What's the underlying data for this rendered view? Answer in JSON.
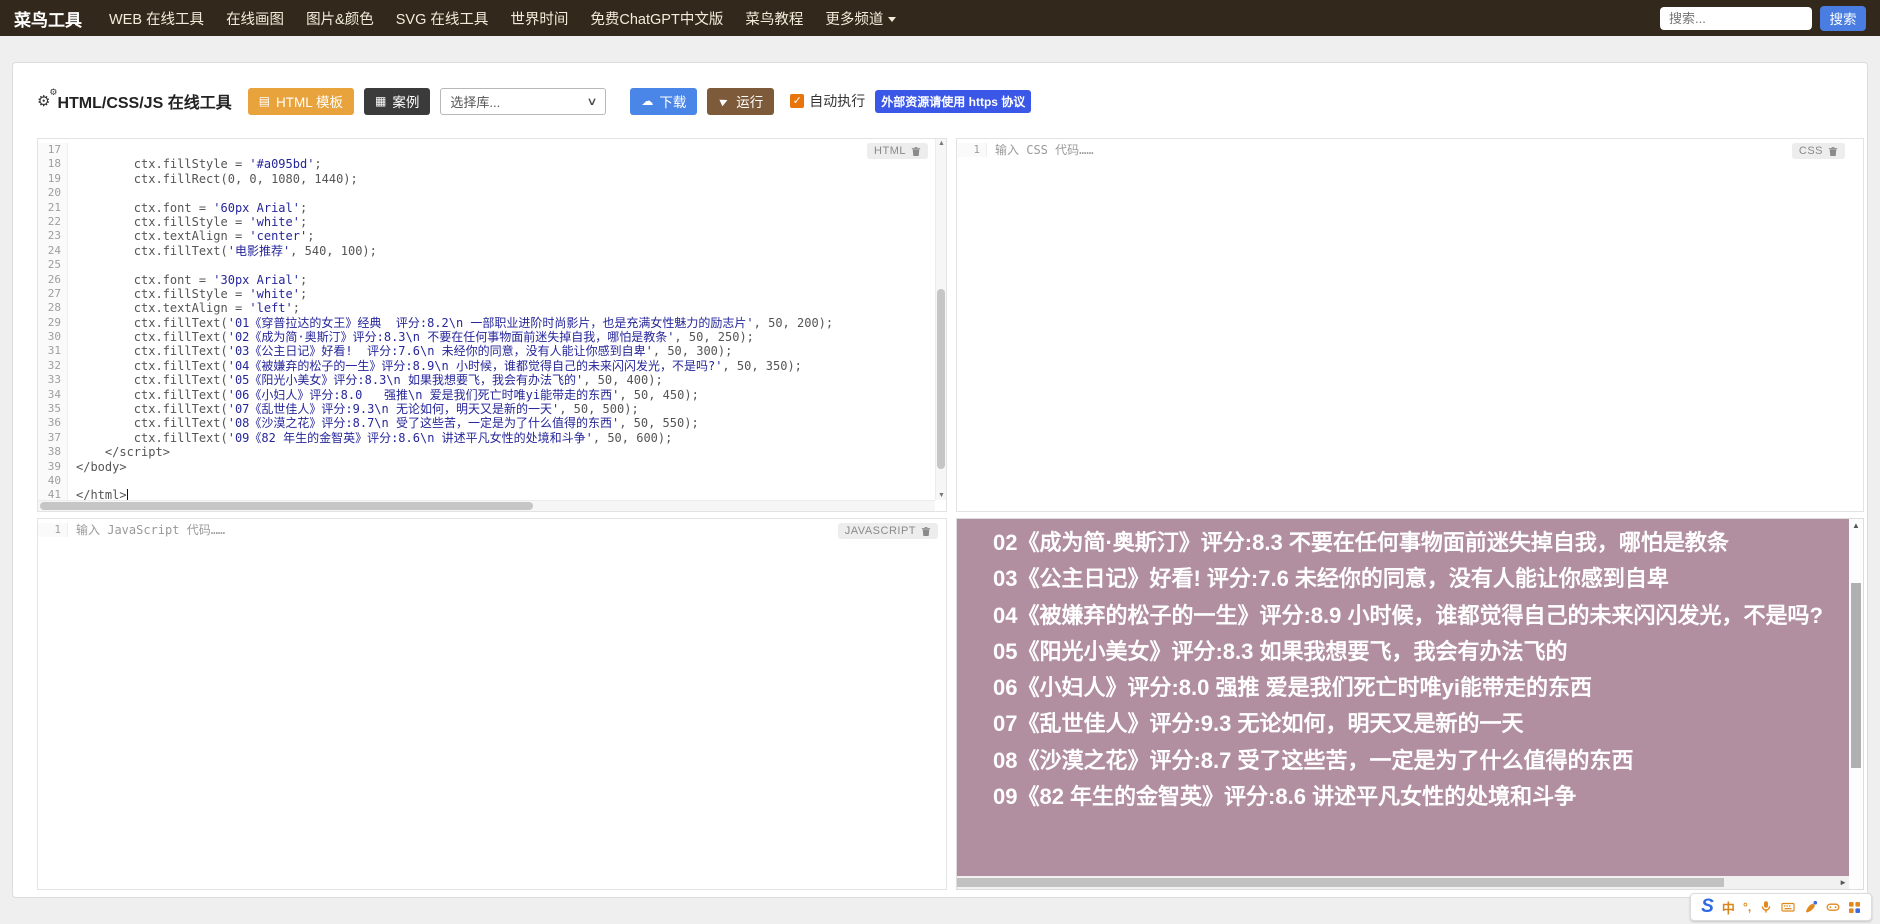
{
  "navbar": {
    "logo": "菜鸟工具",
    "items": [
      {
        "label": "WEB 在线工具"
      },
      {
        "label": "在线画图"
      },
      {
        "label": "图片&颜色"
      },
      {
        "label": "SVG 在线工具"
      },
      {
        "label": "世界时间"
      },
      {
        "label": "免费ChatGPT中文版"
      },
      {
        "label": "菜鸟教程"
      },
      {
        "label": "更多频道",
        "caret": true
      }
    ],
    "search_placeholder": "搜索...",
    "search_button": "搜索"
  },
  "toolbar": {
    "title": "HTML/CSS/JS 在线工具",
    "template_button": "HTML 模板",
    "example_button": "案例",
    "library_select": "选择库...",
    "download_button": "下载",
    "run_button": "运行",
    "autorun_checked": "✓",
    "autorun_label": "自动执行",
    "https_badge": "外部资源请使用 https 协议"
  },
  "editors": {
    "html": {
      "label": "HTML",
      "cursor_line": 41,
      "lines": [
        {
          "no": 17,
          "c": ""
        },
        {
          "no": 18,
          "c": "        ctx.fillStyle = '#a095bd';"
        },
        {
          "no": 19,
          "c": "        ctx.fillRect(0, 0, 1080, 1440);"
        },
        {
          "no": 20,
          "c": ""
        },
        {
          "no": 21,
          "c": "        ctx.font = '60px Arial';"
        },
        {
          "no": 22,
          "c": "        ctx.fillStyle = 'white';"
        },
        {
          "no": 23,
          "c": "        ctx.textAlign = 'center';"
        },
        {
          "no": 24,
          "c": "        ctx.fillText('电影推荐', 540, 100);"
        },
        {
          "no": 25,
          "c": ""
        },
        {
          "no": 26,
          "c": "        ctx.font = '30px Arial';"
        },
        {
          "no": 27,
          "c": "        ctx.fillStyle = 'white';"
        },
        {
          "no": 28,
          "c": "        ctx.textAlign = 'left';"
        },
        {
          "no": 29,
          "c": "        ctx.fillText('01《穿普拉达的女王》经典  评分:8.2\\n 一部职业进阶时尚影片，也是充满女性魅力的励志片', 50, 200);"
        },
        {
          "no": 30,
          "c": "        ctx.fillText('02《成为简·奥斯汀》评分:8.3\\n 不要在任何事物面前迷失掉自我，哪怕是教条', 50, 250);"
        },
        {
          "no": 31,
          "c": "        ctx.fillText('03《公主日记》好看!  评分:7.6\\n 未经你的同意，没有人能让你感到自卑', 50, 300);"
        },
        {
          "no": 32,
          "c": "        ctx.fillText('04《被嫌弃的松子的一生》评分:8.9\\n 小时候，谁都觉得自己的未来闪闪发光，不是吗?', 50, 350);"
        },
        {
          "no": 33,
          "c": "        ctx.fillText('05《阳光小美女》评分:8.3\\n 如果我想要飞，我会有办法飞的', 50, 400);"
        },
        {
          "no": 34,
          "c": "        ctx.fillText('06《小妇人》评分:8.0   强推\\n 爱是我们死亡时唯yi能带走的东西', 50, 450);"
        },
        {
          "no": 35,
          "c": "        ctx.fillText('07《乱世佳人》评分:9.3\\n 无论如何，明天又是新的一天', 50, 500);"
        },
        {
          "no": 36,
          "c": "        ctx.fillText('08《沙漠之花》评分:8.7\\n 受了这些苦，一定是为了什么值得的东西', 50, 550);"
        },
        {
          "no": 37,
          "c": "        ctx.fillText('09《82 年生的金智英》评分:8.6\\n 讲述平凡女性的处境和斗争', 50, 600);"
        },
        {
          "no": 38,
          "c": "    </script>"
        },
        {
          "no": 39,
          "c": "</body>"
        },
        {
          "no": 40,
          "c": ""
        },
        {
          "no": 41,
          "c": "</html>"
        }
      ]
    },
    "css": {
      "label": "CSS",
      "line_no": "1",
      "placeholder": "输入 CSS 代码……"
    },
    "js": {
      "label": "JAVASCRIPT",
      "line_no": "1",
      "placeholder": "输入 JavaScript 代码……"
    }
  },
  "preview": {
    "background": "#b28fa0",
    "lines": [
      "02《成为简·奥斯汀》评分:8.3  不要在任何事物面前迷失掉自我，哪怕是教条",
      "03《公主日记》好看! 评分:7.6  未经你的同意，没有人能让你感到自卑",
      "04《被嫌弃的松子的一生》评分:8.9  小时候，谁都觉得自己的未来闪闪发光，不是吗?",
      "05《阳光小美女》评分:8.3  如果我想要飞，我会有办法飞的",
      "06《小妇人》评分:8.0   强推 爱是我们死亡时唯yi能带走的东西",
      "07《乱世佳人》评分:9.3  无论如何，明天又是新的一天",
      "08《沙漠之花》评分:8.7  受了这些苦，一定是为了什么值得的东西",
      "09《82 年生的金智英》评分:8.6  讲述平凡女性的处境和斗争"
    ]
  },
  "ime": {
    "logo": "S",
    "mode": "中",
    "icons": [
      "sogou-logo",
      "chinese-mode",
      "punctuation",
      "microphone-icon",
      "keyboard-icon",
      "skin-icon",
      "gamepad-icon",
      "grid-icon"
    ]
  },
  "colors": {
    "navbar_bg": "#33281c",
    "template_btn": "#e9a33c",
    "example_btn": "#3b3b3b",
    "download_btn": "#4a86e8",
    "run_btn": "#7d5b3a",
    "https_badge": "#3a57e8",
    "checkbox": "#e8740c",
    "preview_bg": "#b28fa0",
    "code_string": "#26269a"
  }
}
